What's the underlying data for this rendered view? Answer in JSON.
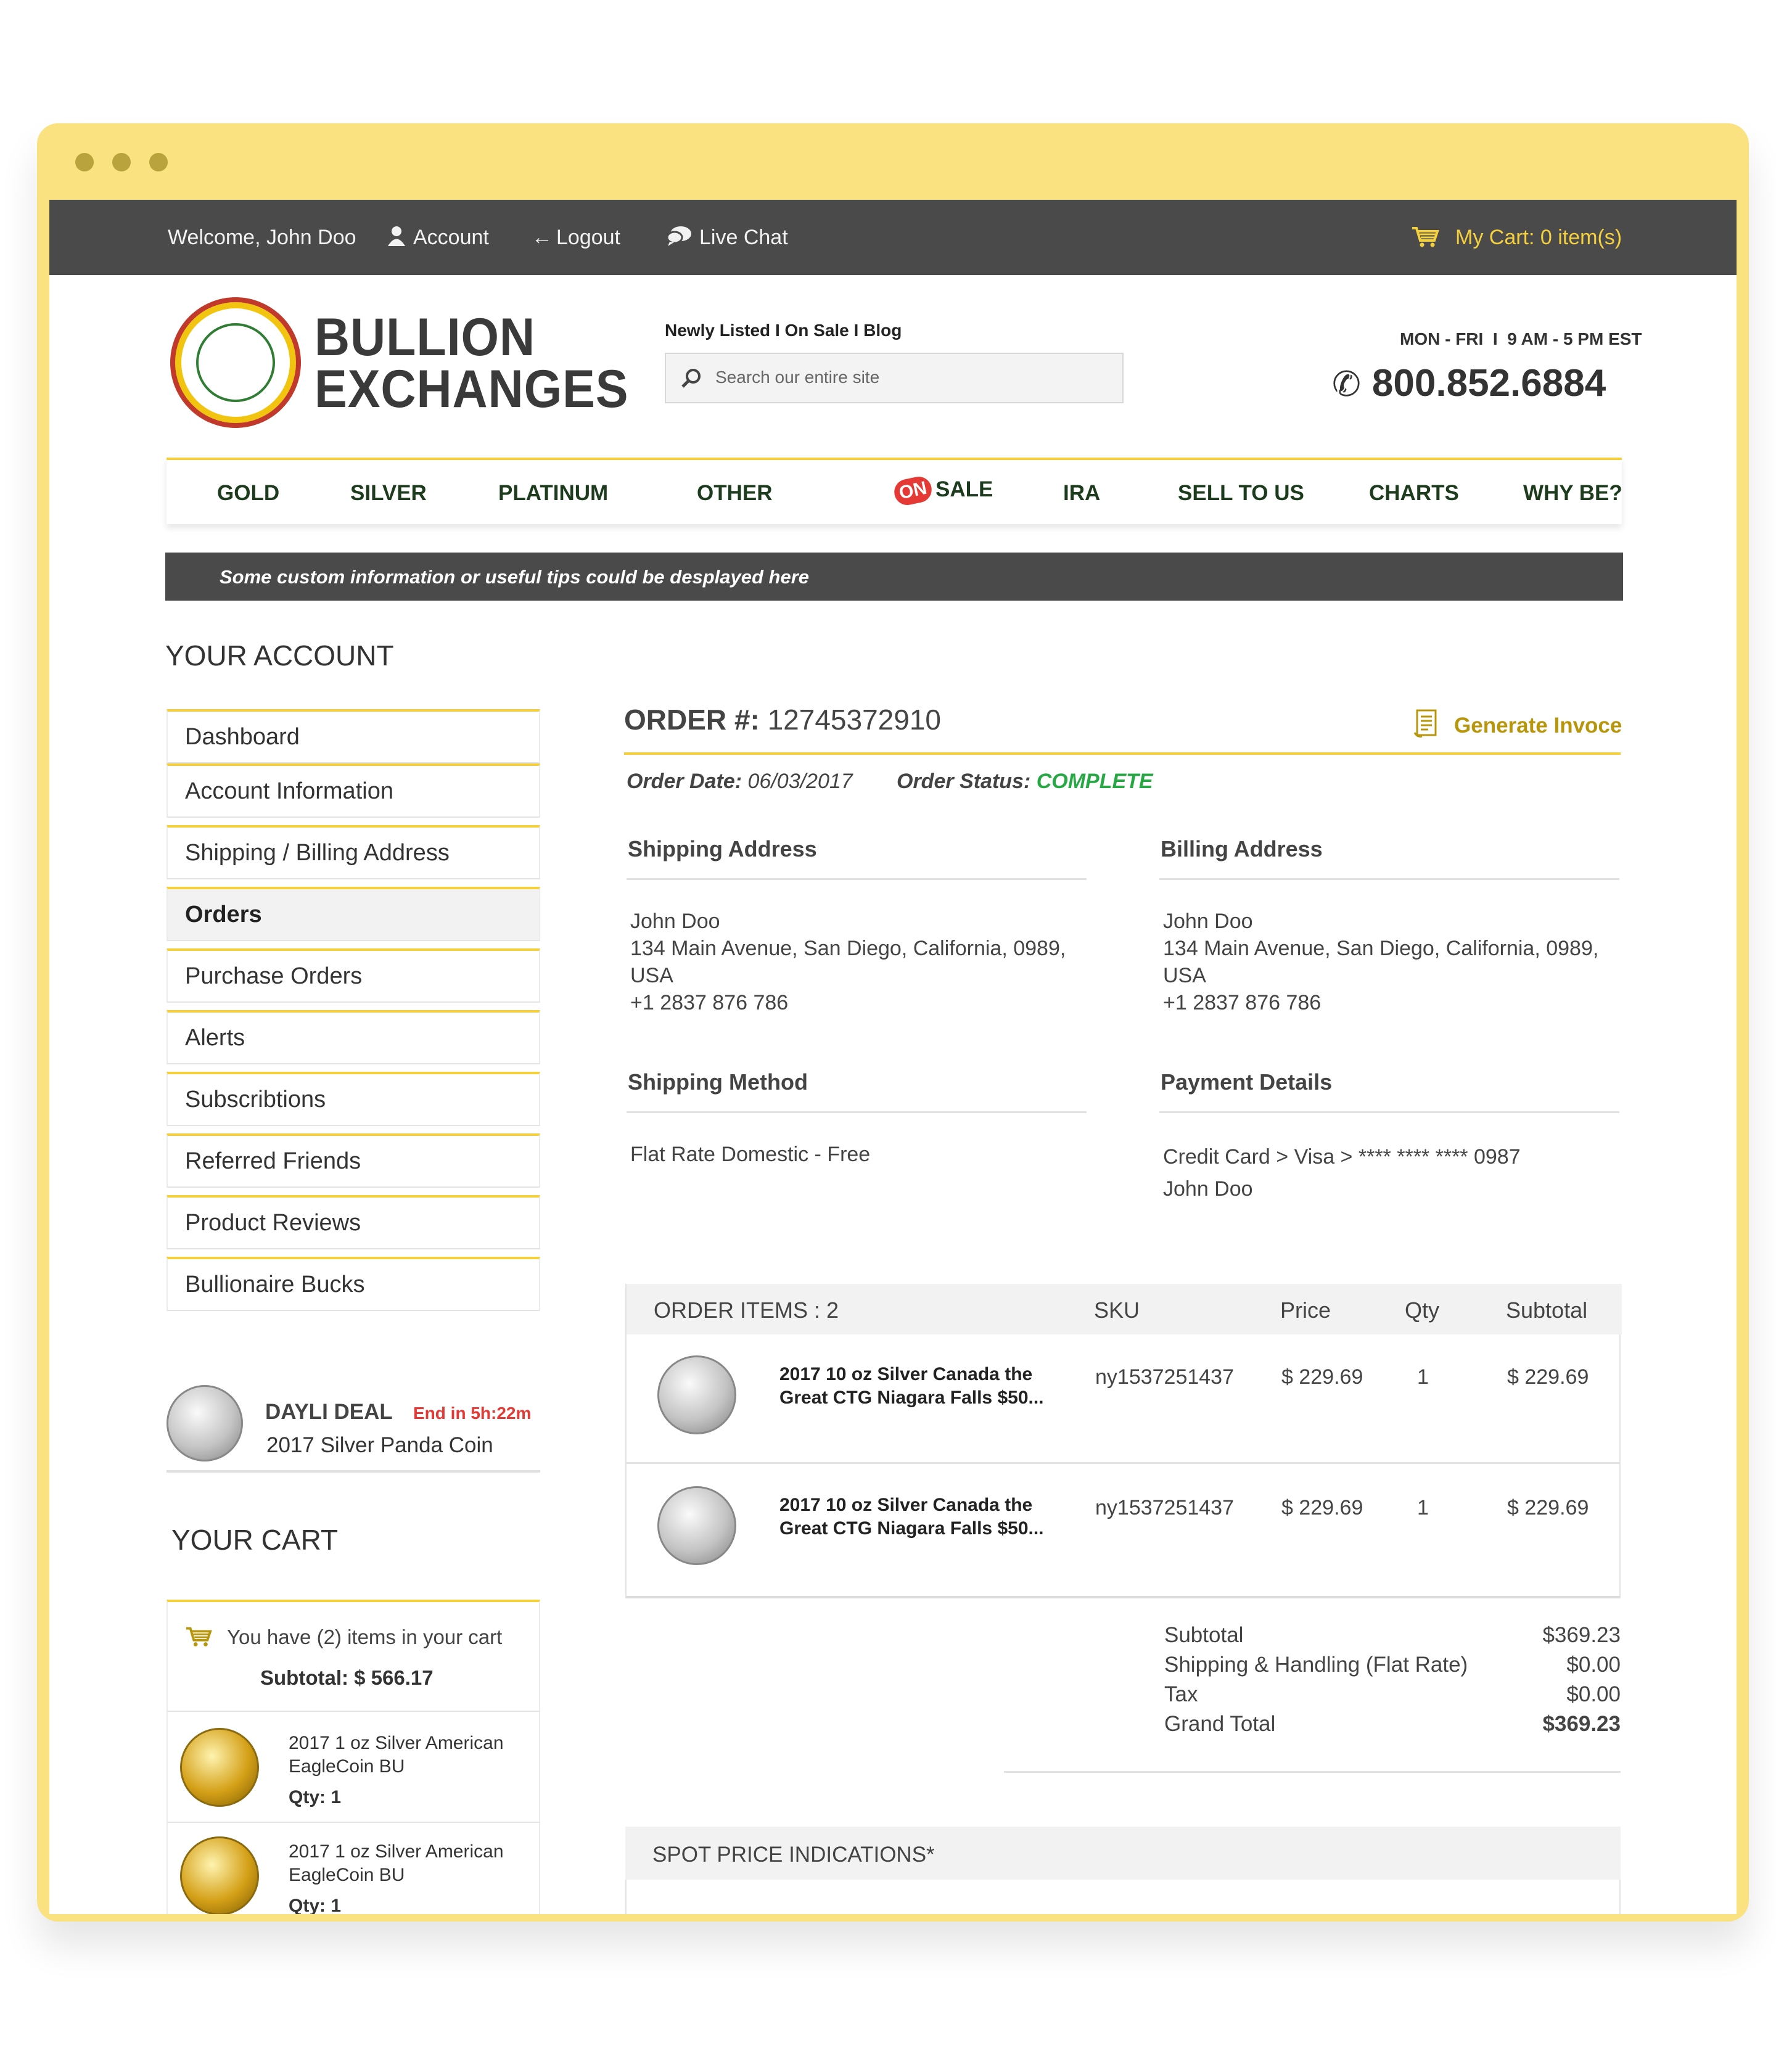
{
  "topbar": {
    "welcome": "Welcome, John Doo",
    "account": "Account",
    "logout": "Logout",
    "live_chat": "Live Chat",
    "cart": "My Cart: 0 item(s)"
  },
  "header": {
    "brand_line1": "BULLION",
    "brand_line2": "EXCHANGES",
    "quick_links": "Newly Listed I On Sale I Blog",
    "search_placeholder": "Search our entire site",
    "hours": "MON - FRI  I  9 AM - 5 PM EST",
    "phone": "800.852.6884"
  },
  "nav": {
    "items": [
      "GOLD",
      "SILVER",
      "PLATINUM",
      "OTHER",
      "SALE",
      "IRA",
      "SELL TO US",
      "CHARTS",
      "WHY BE?"
    ],
    "on_badge": "ON"
  },
  "tip": "Some custom information or useful tips could be desplayed here",
  "sidebar": {
    "title": "YOUR ACCOUNT",
    "items": [
      "Dashboard",
      "Account Information",
      "Shipping / Billing Address",
      "Orders",
      "Purchase Orders",
      "Alerts",
      "Subscribtions",
      "Referred Friends",
      "Product Reviews",
      "Bullionaire Bucks"
    ],
    "deal_label": "DAYLI DEAL",
    "deal_timer": "End in 5h:22m",
    "deal_product": "2017 Silver Panda Coin",
    "cart_title": "YOUR CART",
    "cart_summary": "You have (2) items in your cart",
    "cart_subtotal": "Subtotal: $ 566.17",
    "cart_items": [
      {
        "line1": "2017 1 oz Silver American",
        "line2": "EagleCoin BU",
        "qty": "Qty: 1"
      },
      {
        "line1": "2017 1 oz Silver American",
        "line2": "EagleCoin BU",
        "qty": "Qty: 1"
      }
    ]
  },
  "order": {
    "number_label": "ORDER #:",
    "number": "12745372910",
    "generate_invoice": "Generate Invoce",
    "date_label": "Order Date:",
    "date": "06/03/2017",
    "status_label": "Order Status:",
    "status": "COMPLETE",
    "shipping_address_title": "Shipping Address",
    "billing_address_title": "Billing Address",
    "shipping_address": {
      "name": "John Doo",
      "street": "134 Main Avenue, San Diego, California, 0989,",
      "country": "USA",
      "phone": "+1 2837 876 786"
    },
    "billing_address": {
      "name": "John Doo",
      "street": "134 Main Avenue, San Diego, California, 0989,",
      "country": "USA",
      "phone": "+1 2837 876 786"
    },
    "shipping_method_title": "Shipping Method",
    "shipping_method": "Flat Rate Domestic - Free",
    "payment_title": "Payment Details",
    "payment_line": "Credit Card > Visa > **** **** **** 0987",
    "payment_name": "John Doo"
  },
  "items_table": {
    "headers": [
      "ORDER ITEMS : 2",
      "SKU",
      "Price",
      "Qty",
      "Subtotal"
    ],
    "rows": [
      {
        "name1": "2017 10 oz Silver Canada the",
        "name2": "Great CTG Niagara Falls $50...",
        "sku": "ny1537251437",
        "price": "$ 229.69",
        "qty": "1",
        "subtotal": "$ 229.69"
      },
      {
        "name1": "2017 10 oz Silver Canada the",
        "name2": "Great CTG Niagara Falls $50...",
        "sku": "ny1537251437",
        "price": "$ 229.69",
        "qty": "1",
        "subtotal": "$ 229.69"
      }
    ]
  },
  "totals": [
    {
      "label": "Subtotal",
      "value": "$369.23"
    },
    {
      "label": "Shipping & Handling (Flat Rate)",
      "value": "$0.00"
    },
    {
      "label": "Tax",
      "value": "$0.00"
    },
    {
      "label": "Grand Total",
      "value": "$369.23"
    }
  ],
  "spot": {
    "title": "SPOT PRICE INDICATIONS*"
  },
  "colors": {
    "accent_yellow": "#f4d03f",
    "gold_text": "#b8960c",
    "status_green": "#27a844",
    "dark_bar": "#4a4a4a"
  }
}
